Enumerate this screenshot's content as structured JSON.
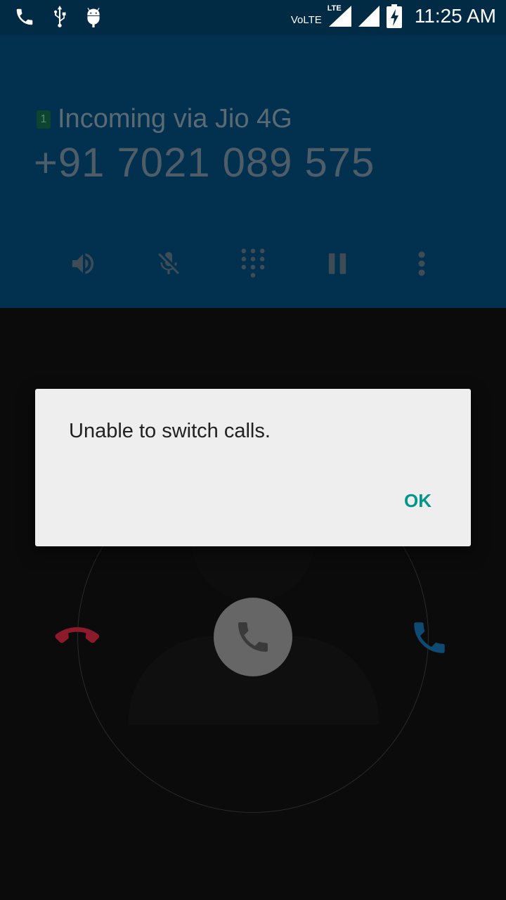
{
  "status_bar": {
    "left_icons": [
      "phone-icon",
      "usb-icon",
      "android-icon"
    ],
    "network_label": "VoLTE",
    "lte_label": "LTE",
    "right_icons": [
      "lte-signal-icon",
      "signal-icon",
      "battery-charging-icon"
    ],
    "time": "11:25 AM"
  },
  "call": {
    "sim_slot": "1",
    "via_text": "Incoming via Jio 4G",
    "phone_number": "+91 7021 089 575",
    "controls": [
      "speaker-icon",
      "mute-icon",
      "dialpad-icon",
      "hold-icon",
      "more-icon"
    ]
  },
  "dialog": {
    "message": "Unable to switch calls.",
    "ok_label": "OK"
  },
  "colors": {
    "status_bar": "#012a44",
    "call_header": "#01314f",
    "background": "#0b0b0b",
    "dialog_bg": "#eeeeee",
    "accent": "#009688",
    "decline": "#8b1a2a",
    "answer": "#0f4a73"
  }
}
